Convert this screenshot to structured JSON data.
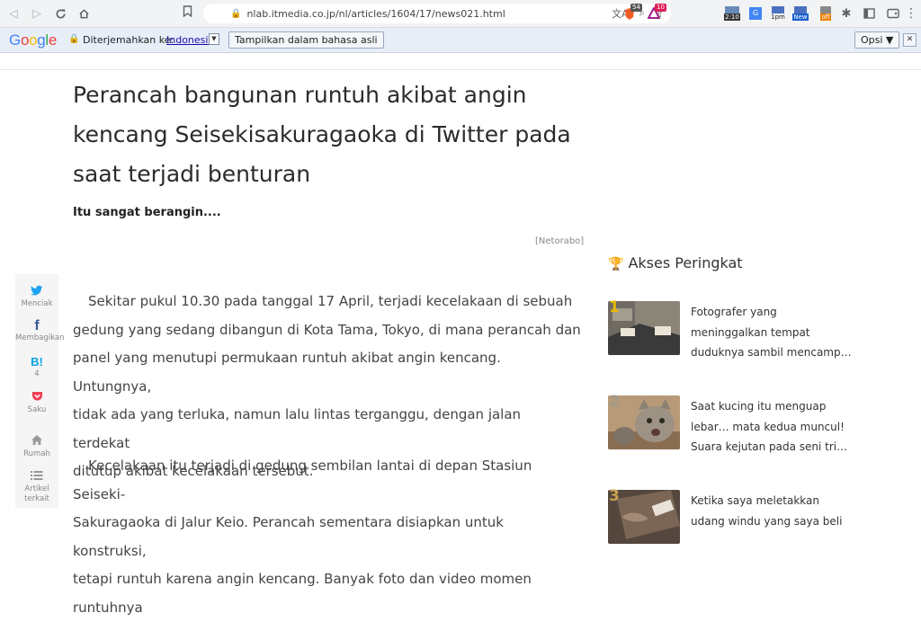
{
  "browser": {
    "url": "nlab.itmedia.co.jp/nl/articles/1604/17/news021.html",
    "extensions": {
      "shield_badge": "54",
      "brave_badge": "10",
      "clock_label": "2:10",
      "time_label": "1pm",
      "new_label": "New",
      "off_label": "off"
    }
  },
  "translate_bar": {
    "logo": [
      "G",
      "o",
      "o",
      "g",
      "l",
      "e"
    ],
    "translated_to_label": "Diterjemahkan ke:",
    "language": "Indonesia",
    "show_original_button": "Tampilkan dalam bahasa asli",
    "options_button": "Opsi ▼",
    "close_symbol": "✕"
  },
  "article": {
    "title_lines": [
      "Perancah bangunan runtuh akibat angin",
      "kencang Seisekisakuragaoka di Twitter pada",
      "saat terjadi benturan"
    ],
    "subtitle": "Itu sangat berangin....",
    "source": "[Netorabo]",
    "para1_lines": [
      "Sekitar pukul 10.30 pada tanggal 17 April, terjadi kecelakaan di sebuah",
      "gedung yang sedang dibangun di Kota Tama, Tokyo, di mana perancah dan",
      "panel yang menutupi permukaan runtuh akibat angin kencang. Untungnya,",
      "tidak ada yang terluka, namun lalu lintas terganggu, dengan jalan terdekat",
      "ditutup akibat kecelakaan tersebut."
    ],
    "para2_lines": [
      "Kecelakaan itu terjadi di gedung sembilan lantai di depan Stasiun Seiseki-",
      "Sakuragaoka di Jalur Keio. Perancah sementara disiapkan untuk konstruksi,",
      "tetapi runtuh karena angin kencang. Banyak foto dan video momen runtuhnya"
    ]
  },
  "share": {
    "items": [
      {
        "label": "Menciak",
        "icon": "twitter-icon"
      },
      {
        "label": "Membagikan",
        "icon": "facebook-icon"
      },
      {
        "label": "4",
        "icon": "hatena-icon",
        "glyph": "B!"
      },
      {
        "label": "Saku",
        "icon": "pocket-icon"
      },
      {
        "label": "Rumah",
        "icon": "home-icon"
      },
      {
        "label": "Artikel terkait",
        "icon": "list-icon"
      }
    ]
  },
  "ranking": {
    "heading": "Akses Peringkat",
    "items": [
      {
        "rank": "1",
        "color": "#e6b800",
        "lines": [
          "Fotografer yang",
          "meninggalkan tempat",
          "duduknya sambil mencamp…"
        ]
      },
      {
        "rank": "2",
        "color": "#a09a8a",
        "lines": [
          "Saat kucing itu menguap",
          "lebar… mata kedua muncul!",
          "Suara kejutan pada seni tri…"
        ]
      },
      {
        "rank": "3",
        "color": "#c8a050",
        "lines": [
          "Ketika saya meletakkan",
          "udang windu yang saya beli"
        ]
      }
    ]
  },
  "colors": {
    "twitter": "#1da1f2",
    "facebook": "#3b5998",
    "hatena": "#00a4de",
    "pocket": "#ef4056"
  }
}
